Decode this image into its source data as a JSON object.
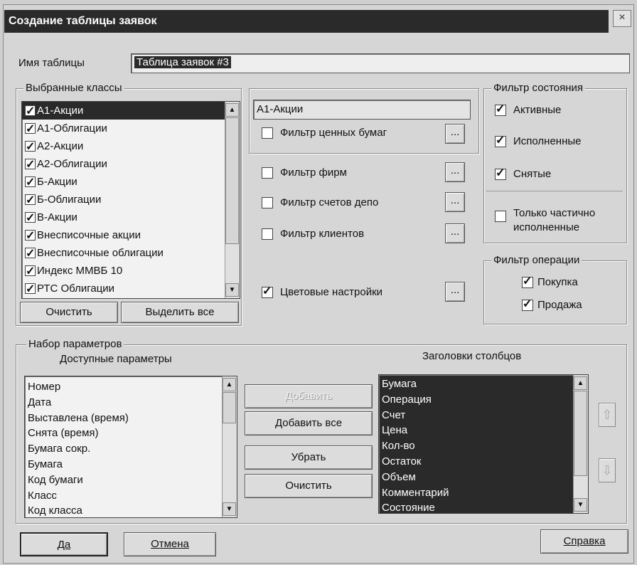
{
  "window": {
    "title": "Создание таблицы заявок",
    "close": "×"
  },
  "table_name": {
    "label": "Имя таблицы",
    "value": "Таблица заявок #3"
  },
  "classes": {
    "title": "Выбранные классы",
    "items": [
      {
        "label": "А1-Акции",
        "checked": true,
        "selected": true
      },
      {
        "label": "А1-Облигации",
        "checked": true
      },
      {
        "label": "А2-Акции",
        "checked": true
      },
      {
        "label": "А2-Облигации",
        "checked": true
      },
      {
        "label": "Б-Акции",
        "checked": true
      },
      {
        "label": "Б-Облигации",
        "checked": true
      },
      {
        "label": "В-Акции",
        "checked": true
      },
      {
        "label": "Внесписочные акции",
        "checked": true
      },
      {
        "label": "Внесписочные облигации",
        "checked": true
      },
      {
        "label": "Индекс ММВБ 10",
        "checked": true
      },
      {
        "label": "РТС Облигации",
        "checked": true
      }
    ],
    "clear_button": "Очистить",
    "select_all_button": "Выделить все"
  },
  "securities": {
    "current_class": "А1-Акции",
    "securities_filter": "Фильтр ценных бумаг",
    "firms_filter": "Фильтр фирм",
    "depo_filter": "Фильтр счетов депо",
    "clients_filter": "Фильтр клиентов",
    "color_settings": "Цветовые настройки",
    "ellipsis": "..."
  },
  "state_filter": {
    "title": "Фильтр состояния",
    "active": "Активные",
    "executed": "Исполненные",
    "cancelled": "Снятые",
    "partial": [
      "Только частично",
      "исполненные"
    ]
  },
  "operation_filter": {
    "title": "Фильтр операции",
    "buy": "Покупка",
    "sell": "Продажа"
  },
  "params": {
    "title": "Набор параметров",
    "available_title": "Доступные параметры",
    "columns_title": "Заголовки столбцов",
    "available": [
      "Номер",
      "Дата",
      "Выставлена (время)",
      "Снята (время)",
      "Бумага сокр.",
      "Бумага",
      "Код бумаги",
      "Класс",
      "Код класса"
    ],
    "columns": [
      "Бумага",
      "Операция",
      "Счет",
      "Цена",
      "Кол-во",
      "Остаток",
      "Объем",
      "Комментарий",
      "Состояние"
    ],
    "add": "Добавить",
    "add_all": "Добавить все",
    "remove": "Убрать",
    "clear": "Очистить"
  },
  "footer": {
    "ok": "Да",
    "cancel": "Отмена",
    "help": "Справка"
  },
  "icons": {
    "up_arrow": "⇧",
    "down_arrow": "⇩",
    "scroll_up": "▲",
    "scroll_down": "▼"
  }
}
